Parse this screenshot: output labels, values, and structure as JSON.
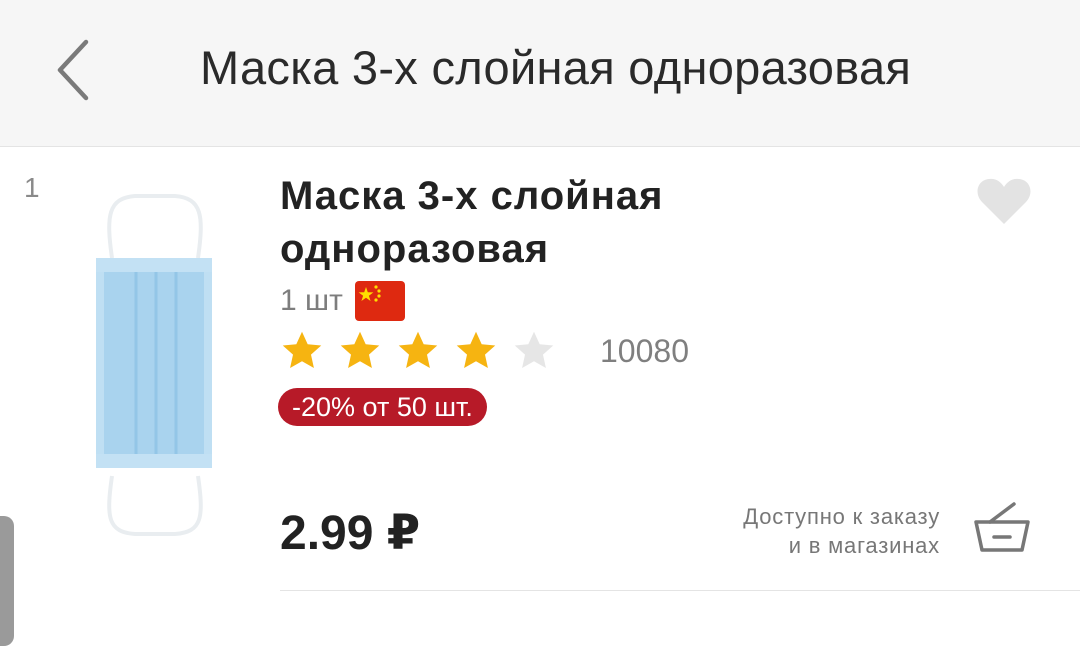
{
  "header": {
    "title": "Маска 3-х слойная одноразовая",
    "back_icon": "chevron-left-icon"
  },
  "product": {
    "index": "1",
    "title": "Маска  3-х слойная одноразовая",
    "unit": "1 шт",
    "origin_flag": "china-flag-icon",
    "rating": {
      "value": 4,
      "max": 5,
      "reviews": "10080"
    },
    "discount_badge": "-20% от 50 шт.",
    "price": "2.99 ₽",
    "availability": {
      "line1": "Доступно к заказу",
      "line2": "и в магазинах"
    },
    "favorite_icon": "heart-icon",
    "cart_icon": "basket-icon"
  },
  "colors": {
    "star_filled": "#f6b411",
    "star_empty": "#e6e6e6",
    "discount_bg": "#b71a28",
    "flag_red": "#de2910",
    "flag_yellow": "#ffde00"
  }
}
